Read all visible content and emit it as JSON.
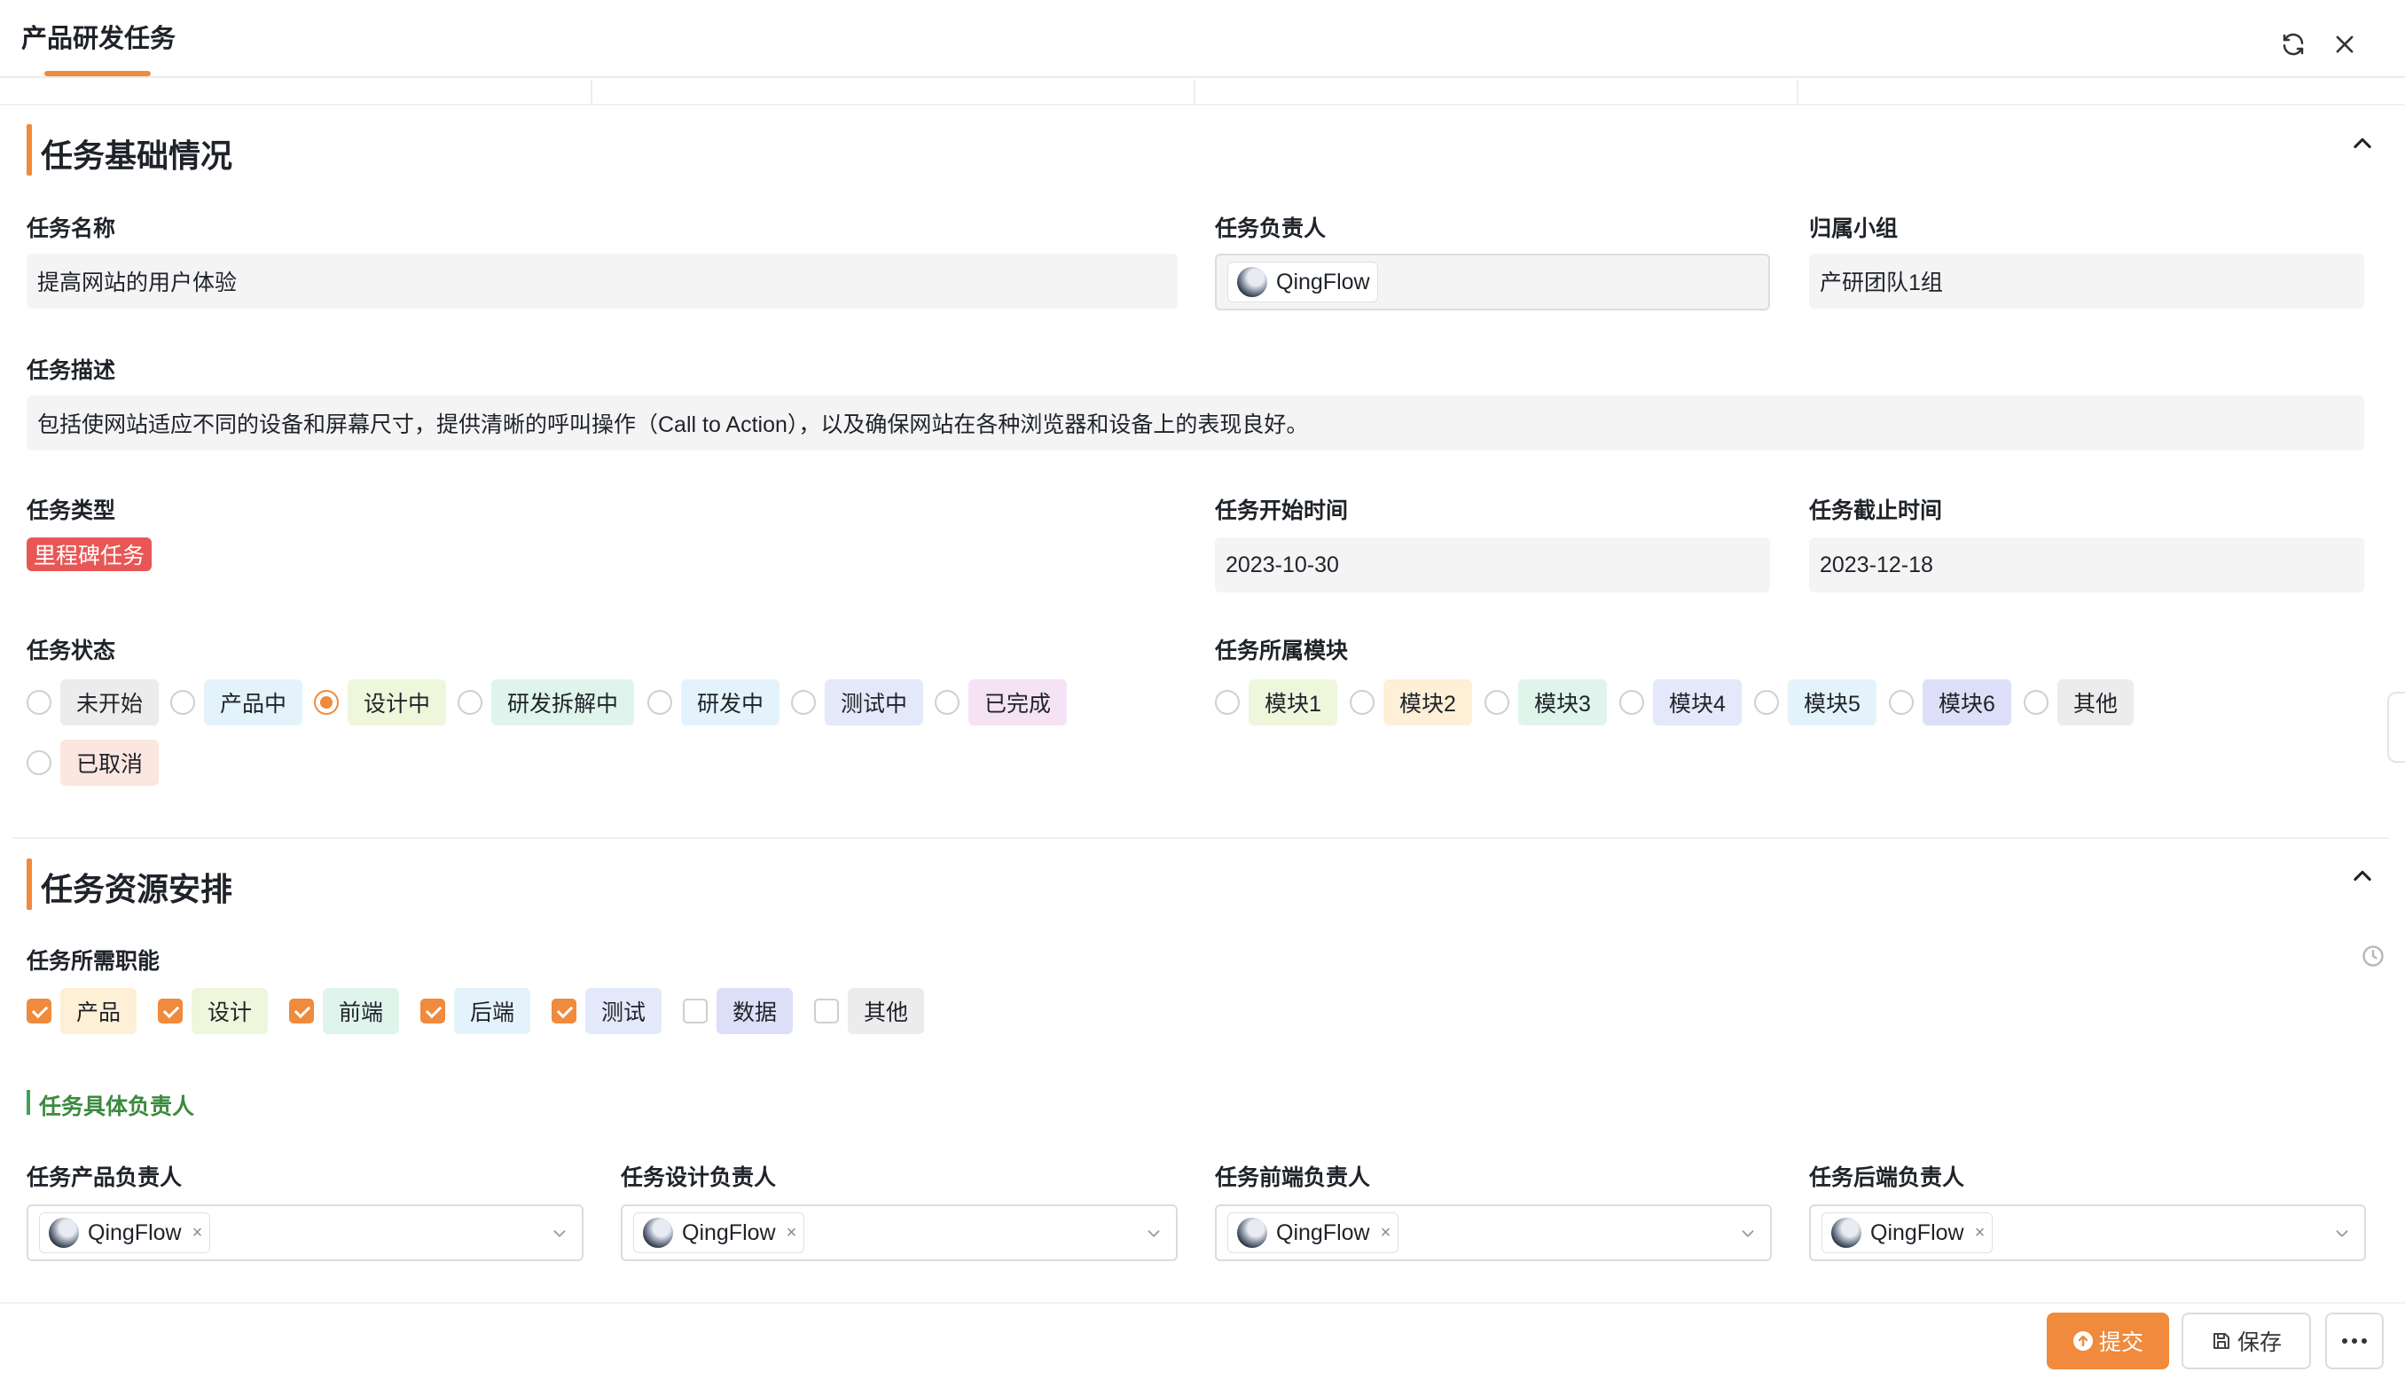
{
  "header": {
    "title": "产品研发任务"
  },
  "sections": {
    "basic": {
      "title": "任务基础情况"
    },
    "resource": {
      "title": "任务资源安排"
    }
  },
  "fields": {
    "task_name": {
      "label": "任务名称",
      "value": "提高网站的用户体验"
    },
    "owner": {
      "label": "任务负责人",
      "value": "QingFlow"
    },
    "group": {
      "label": "归属小组",
      "value": "产研团队1组"
    },
    "description": {
      "label": "任务描述",
      "value": "包括使网站适应不同的设备和屏幕尺寸，提供清晰的呼叫操作（Call to Action），以及确保网站在各种浏览器和设备上的表现良好。"
    },
    "type": {
      "label": "任务类型",
      "value": "里程碑任务"
    },
    "start": {
      "label": "任务开始时间",
      "value": "2023-10-30"
    },
    "end": {
      "label": "任务截止时间",
      "value": "2023-12-18"
    },
    "status": {
      "label": "任务状态",
      "options": [
        {
          "label": "未开始",
          "selected": false,
          "color": "#ececec"
        },
        {
          "label": "产品中",
          "selected": false,
          "color": "#e4f3fb"
        },
        {
          "label": "设计中",
          "selected": true,
          "color": "#eef7dc"
        },
        {
          "label": "研发拆解中",
          "selected": false,
          "color": "#dff5ec"
        },
        {
          "label": "研发中",
          "selected": false,
          "color": "#e4f3fb"
        },
        {
          "label": "测试中",
          "selected": false,
          "color": "#e3e8fa"
        },
        {
          "label": "已完成",
          "selected": false,
          "color": "#f5e3f5"
        },
        {
          "label": "已取消",
          "selected": false,
          "color": "#fbe6e0"
        }
      ]
    },
    "module": {
      "label": "任务所属模块",
      "options": [
        {
          "label": "模块1",
          "selected": false,
          "color": "#eef7dc"
        },
        {
          "label": "模块2",
          "selected": false,
          "color": "#fdf0d6"
        },
        {
          "label": "模块3",
          "selected": false,
          "color": "#dff5ec"
        },
        {
          "label": "模块4",
          "selected": false,
          "color": "#e3e8fa"
        },
        {
          "label": "模块5",
          "selected": false,
          "color": "#e4f3fb"
        },
        {
          "label": "模块6",
          "selected": false,
          "color": "#dcdff7"
        },
        {
          "label": "其他",
          "selected": false,
          "color": "#ececec"
        }
      ]
    },
    "skills": {
      "label": "任务所需职能",
      "options": [
        {
          "label": "产品",
          "checked": true,
          "color": "#fdf0d6"
        },
        {
          "label": "设计",
          "checked": true,
          "color": "#eef7dc"
        },
        {
          "label": "前端",
          "checked": true,
          "color": "#dff5ec"
        },
        {
          "label": "后端",
          "checked": true,
          "color": "#e4f3fb"
        },
        {
          "label": "测试",
          "checked": true,
          "color": "#e3e8fa"
        },
        {
          "label": "数据",
          "checked": false,
          "color": "#dcdff7"
        },
        {
          "label": "其他",
          "checked": false,
          "color": "#ececec"
        }
      ]
    }
  },
  "subsection": {
    "title": "任务具体负责人"
  },
  "assignees": [
    {
      "label": "任务产品负责人",
      "value": "QingFlow"
    },
    {
      "label": "任务设计负责人",
      "value": "QingFlow"
    },
    {
      "label": "任务前端负责人",
      "value": "QingFlow"
    },
    {
      "label": "任务后端负责人",
      "value": "QingFlow"
    }
  ],
  "footer": {
    "submit": "提交",
    "save": "保存"
  },
  "icons": {
    "refresh": "refresh-icon",
    "close": "close-icon",
    "collapse": "chevron-up-icon",
    "history": "history-icon",
    "dropdown": "chevron-down-icon",
    "submit": "upload-circle-icon",
    "save": "floppy-disk-icon",
    "more": "more-horizontal-icon"
  },
  "colors": {
    "accent": "#f08a3c",
    "milestone_tag": "#e95656",
    "subhead_green": "#3a8a3e"
  }
}
